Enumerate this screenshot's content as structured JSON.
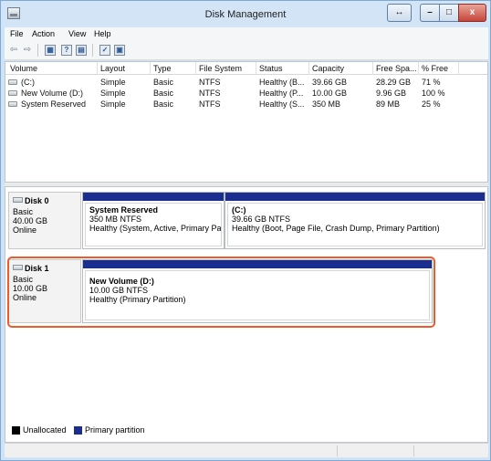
{
  "window": {
    "title": "Disk Management",
    "resize_glyph": "↔",
    "min_glyph": "–",
    "max_glyph": "□",
    "close_glyph": "x",
    "close_color": "#c7453a"
  },
  "menu": [
    "File",
    "Action",
    "View",
    "Help"
  ],
  "toolbar": {
    "icons": [
      "back-arrow-icon",
      "forward-arrow-icon",
      "properties-list-icon",
      "help-icon",
      "view-icon",
      "checklist-icon",
      "disk-settings-icon"
    ],
    "back": "⇦",
    "forward": "⇨",
    "help": "?"
  },
  "volume_table": {
    "columns": [
      "Volume",
      "Layout",
      "Type",
      "File System",
      "Status",
      "Capacity",
      "Free Spa...",
      "% Free"
    ],
    "rows": [
      [
        "(C:)",
        "Simple",
        "Basic",
        "NTFS",
        "Healthy (B...",
        "39.66 GB",
        "28.29 GB",
        "71 %"
      ],
      [
        "New Volume (D:)",
        "Simple",
        "Basic",
        "NTFS",
        "Healthy (P...",
        "10.00 GB",
        "9.96 GB",
        "100 %"
      ],
      [
        "System Reserved",
        "Simple",
        "Basic",
        "NTFS",
        "Healthy (S...",
        "350 MB",
        "89 MB",
        "25 %"
      ]
    ]
  },
  "disks": [
    {
      "name": "Disk 0",
      "type": "Basic",
      "size": "40.00 GB",
      "state": "Online",
      "partitions": [
        {
          "name": "System Reserved",
          "size": "350 MB NTFS",
          "status": "Healthy (System, Active, Primary Part"
        },
        {
          "name": "(C:)",
          "size": "39.66 GB NTFS",
          "status": "Healthy (Boot, Page File, Crash Dump, Primary Partition)"
        }
      ]
    },
    {
      "name": "Disk 1",
      "type": "Basic",
      "size": "10.00 GB",
      "state": "Online",
      "partitions": [
        {
          "name": "New Volume  (D:)",
          "size": "10.00 GB NTFS",
          "status": "Healthy (Primary Partition)"
        }
      ]
    }
  ],
  "legend": {
    "unallocated": "Unallocated",
    "primary": "Primary partition",
    "unallocated_color": "#000000",
    "primary_color": "#1b2d8f"
  },
  "highlight_color": "#ef5a2a"
}
